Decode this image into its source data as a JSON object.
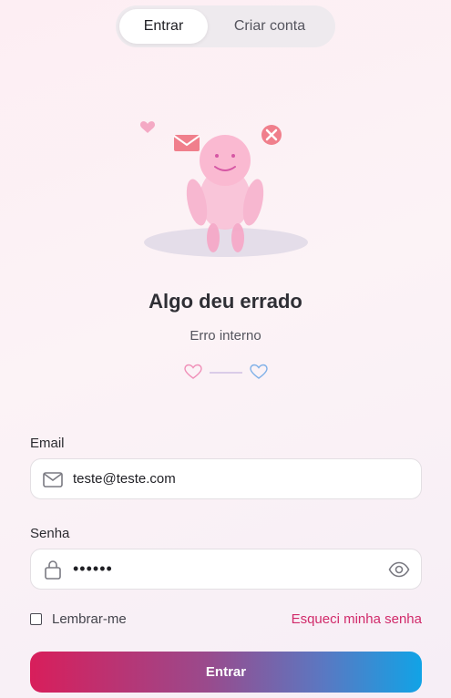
{
  "tabs": {
    "login": "Entrar",
    "register": "Criar conta"
  },
  "error": {
    "title": "Algo deu errado",
    "message": "Erro interno"
  },
  "form": {
    "email_label": "Email",
    "email_value": "teste@teste.com",
    "password_label": "Senha",
    "password_value": "••••••",
    "remember_label": "Lembrar-me",
    "forgot_label": "Esqueci minha senha",
    "submit_label": "Entrar"
  },
  "icons": {
    "email": "mail-icon",
    "password": "lock-icon",
    "toggle_password": "eye-icon",
    "divider_left": "heart-outline-icon",
    "divider_right": "heart-outline-icon"
  },
  "colors": {
    "accent_pink": "#d12a6a",
    "button_gradient_start": "#d81e5b",
    "button_gradient_end": "#11a3e6"
  }
}
